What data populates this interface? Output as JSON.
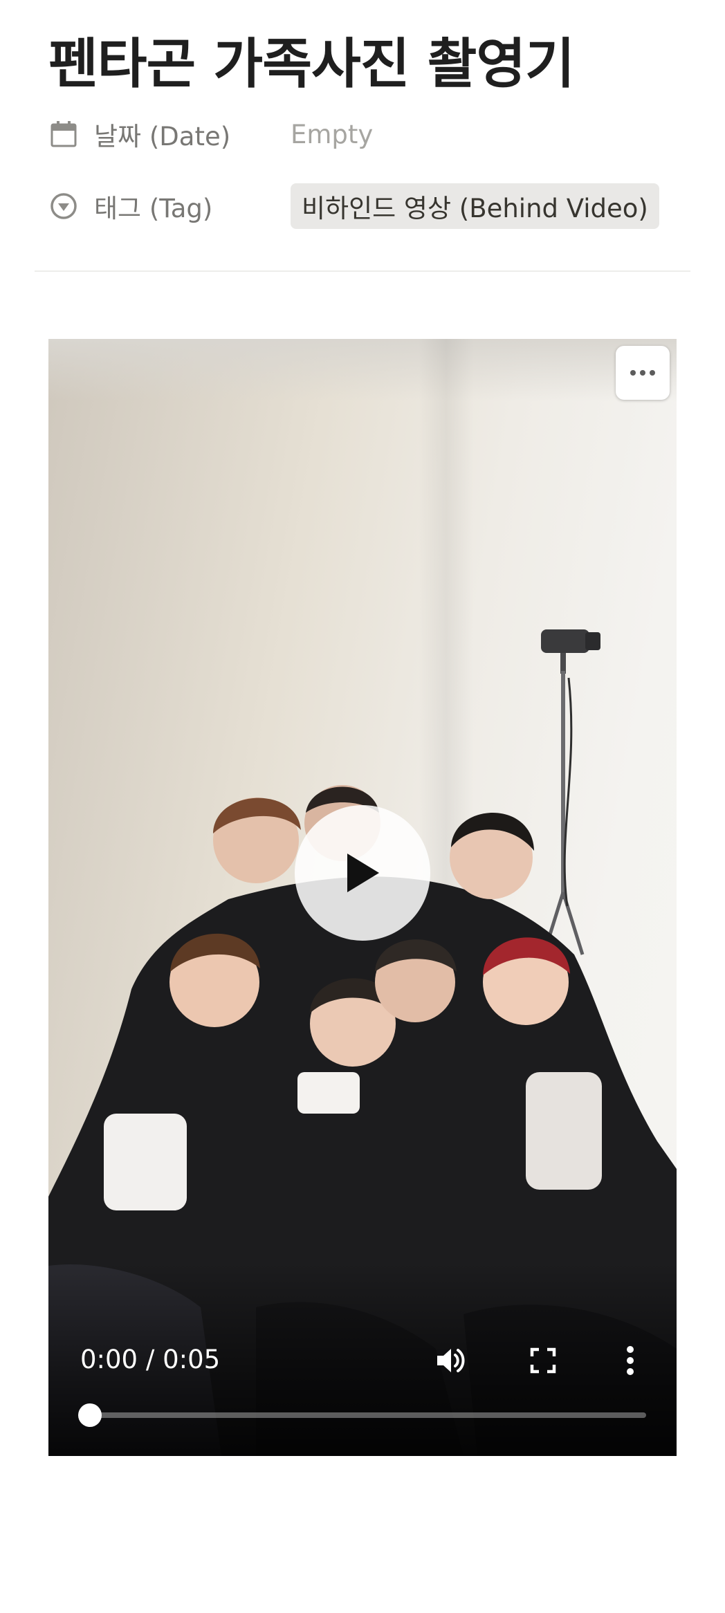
{
  "page": {
    "title": "펜타곤 가족사진 촬영기"
  },
  "properties": {
    "date": {
      "icon": "calendar-icon",
      "label": "날짜 (Date)",
      "value": "Empty"
    },
    "tag": {
      "icon": "select-circle-icon",
      "label": "태그 (Tag)",
      "value": "비하인드 영상 (Behind Video)"
    }
  },
  "video": {
    "time_display": "0:00 / 0:05",
    "progress": 0,
    "icons": {
      "menu": "more-horizontal-icon",
      "play": "play-icon",
      "volume": "volume-icon",
      "fullscreen": "fullscreen-icon",
      "more": "more-vertical-icon"
    }
  },
  "colors": {
    "title": "#1f1f1f",
    "label": "#787774",
    "placeholder": "#a6a5a1",
    "tag_bg": "#e9e8e6",
    "divider": "#ededeb"
  }
}
